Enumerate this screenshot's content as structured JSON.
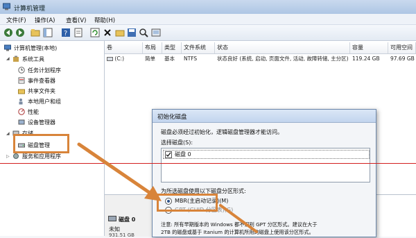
{
  "window": {
    "title": "计算机管理"
  },
  "menu": [
    "文件(F)",
    "操作(A)",
    "查看(V)",
    "帮助(H)"
  ],
  "tree": {
    "root": "计算机管理(本地)",
    "system_tools": "系统工具",
    "items": [
      "任务计划程序",
      "事件查看器",
      "共享文件夹",
      "本地用户和组",
      "性能",
      "设备管理器"
    ],
    "storage": "存储",
    "disk_mgmt": "磁盘管理",
    "services": "服务和应用程序"
  },
  "columns": [
    "卷",
    "布局",
    "类型",
    "文件系统",
    "状态",
    "容量",
    "可用空间"
  ],
  "volumes": [
    [
      "(C:)",
      "简单",
      "基本",
      "NTFS",
      "状态良好 (系统, 启动, 页面文件, 活动, 故障转储, 主分区)",
      "119.24 GB",
      "97.69 GB"
    ]
  ],
  "lower": {
    "disk_name": "磁盘 0",
    "status": "未知",
    "size": "931.51 GB"
  },
  "dialog": {
    "title": "初始化磁盘",
    "line1": "磁盘必须经过初始化，逻辑磁盘管理器才能访问。",
    "select_label": "选择磁盘(S):",
    "disk_item": "磁盘 0",
    "style_label": "为所选磁盘使用以下磁盘分区形式:",
    "opt_mbr": "MBR(主启动记录)(M)",
    "opt_gpt": "GPT (GUID 分区表)(G)",
    "note1": "注意: 所有早期版本的 Windows 都不识别 GPT 分区形式。建议在大于",
    "note2": "2TB 的磁盘或基于 Itanium 的计算机所用的磁盘上使用该分区形式。"
  },
  "colors": {
    "highlight": "#d8843a",
    "redline": "#d21e1e"
  }
}
